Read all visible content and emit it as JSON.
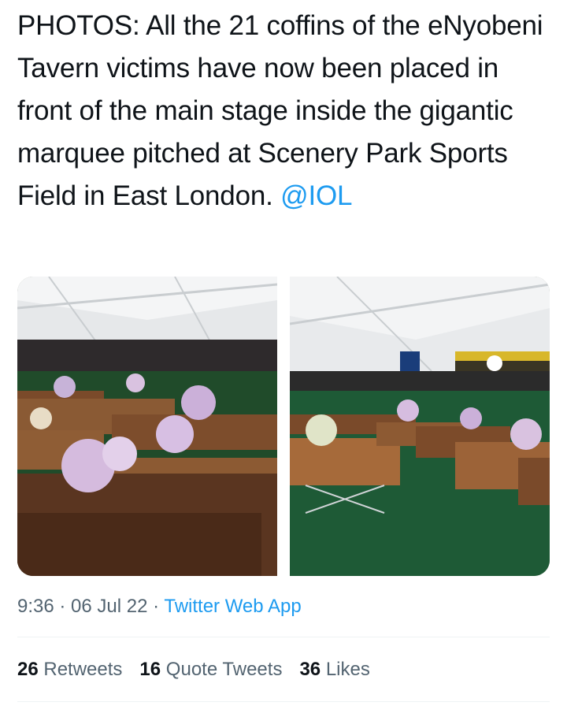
{
  "tweet": {
    "text": "PHOTOS: All the 21 coffins of the eNyobeni Tavern victims have now been placed in front of the main stage inside the gigantic marquee pitched at Scenery Park Sports Field in East London. ",
    "mention": "@IOL",
    "media": [
      {
        "icon": "photo-coffins-left"
      },
      {
        "icon": "photo-coffins-right"
      }
    ],
    "time": "9:36",
    "separator1": " · ",
    "date": "06 Jul 22",
    "separator2": " · ",
    "source": "Twitter Web App"
  },
  "stats": {
    "retweets_count": "26",
    "retweets_label": "Retweets",
    "quotes_count": "16",
    "quotes_label": "Quote Tweets",
    "likes_count": "36",
    "likes_label": "Likes"
  },
  "colors": {
    "accent": "#1d9bf0",
    "text": "#0f1419",
    "secondary": "#536471",
    "divider": "#eff3f4"
  }
}
